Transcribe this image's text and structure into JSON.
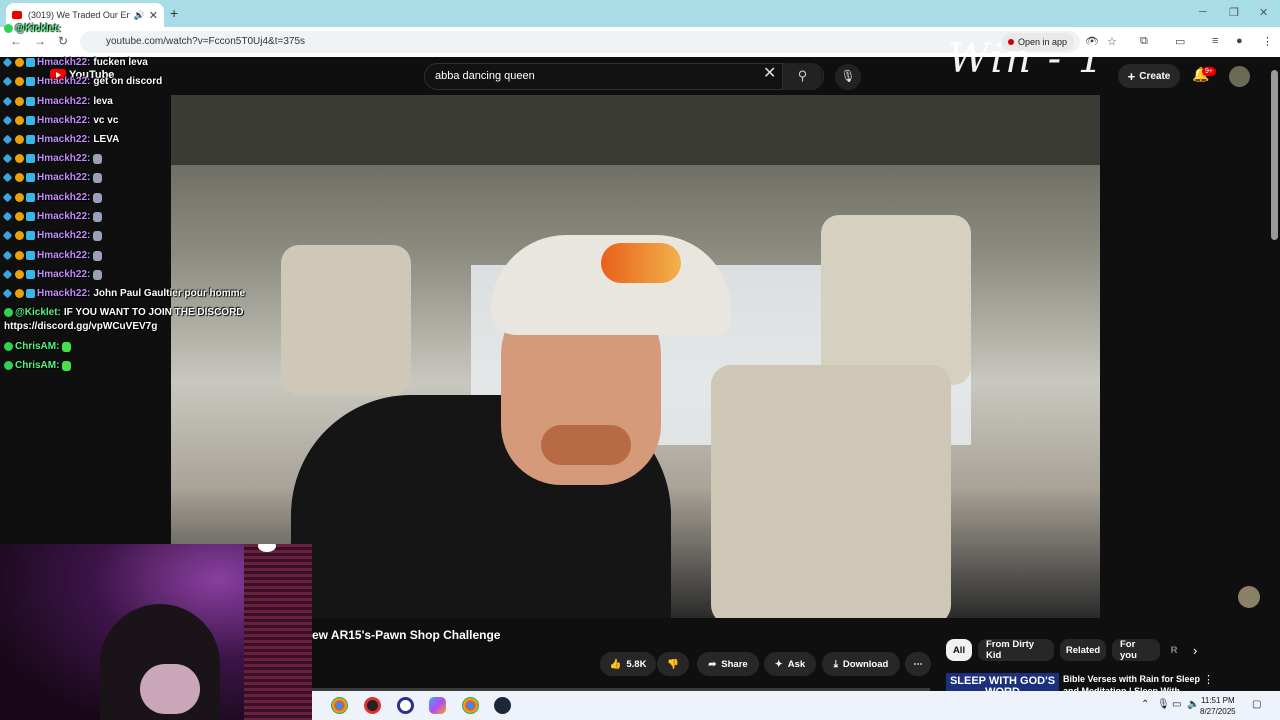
{
  "browser": {
    "tab_title": "(3019) We Traded Our Ent...",
    "url": "youtube.com/watch?v=Fccon5T0Uj4&t=375s",
    "open_in_app": "Open in app"
  },
  "youtube": {
    "logo_text": "YouTube",
    "search_value": "abba dancing queen",
    "create_label": "Create",
    "notif_badge": "9+",
    "video_title": "ew AR15's-Pawn Shop Challenge",
    "like_count": "5.8K",
    "share_label": "Share",
    "ask_label": "Ask",
    "download_label": "Download",
    "chips": [
      "All",
      "From Dirty Kid",
      "Related",
      "For you",
      "R"
    ],
    "rec": {
      "thumb_text": "SLEEP WITH GOD'S WORD",
      "title": "Bible Verses with Rain for Sleep and Meditation | Sleep With"
    }
  },
  "overlay": {
    "win_text": "Win - 1"
  },
  "chat": [
    {
      "user": "@Kicklet:",
      "text": "",
      "color": "green"
    },
    {
      "user": "Hmackh22:",
      "text": "fucken leva",
      "color": "purple"
    },
    {
      "user": "Hmackh22:",
      "text": "get on discord",
      "color": "purple"
    },
    {
      "user": "Hmackh22:",
      "text": "leva",
      "color": "purple"
    },
    {
      "user": "Hmackh22:",
      "text": "vc vc",
      "color": "purple"
    },
    {
      "user": "Hmackh22:",
      "text": "LEVA",
      "color": "purple"
    },
    {
      "user": "Hmackh22:",
      "text": "",
      "color": "purple"
    },
    {
      "user": "Hmackh22:",
      "text": "",
      "color": "purple"
    },
    {
      "user": "Hmackh22:",
      "text": "",
      "color": "purple"
    },
    {
      "user": "Hmackh22:",
      "text": "",
      "color": "purple"
    },
    {
      "user": "Hmackh22:",
      "text": "",
      "color": "purple"
    },
    {
      "user": "Hmackh22:",
      "text": "",
      "color": "purple"
    },
    {
      "user": "Hmackh22:",
      "text": "",
      "color": "purple"
    },
    {
      "user": "Hmackh22:",
      "text": "John Paul Gaultier pour homme",
      "color": "purple"
    },
    {
      "user": "@Kicklet:",
      "text": "IF YOU WANT TO JOIN THE DISCORD",
      "color": "green"
    },
    {
      "user": "",
      "text": "https://discord.gg/vpWCuVEV7g",
      "color": "white"
    },
    {
      "user": "ChrisAM:",
      "text": "",
      "color": "green"
    },
    {
      "user": "ChrisAM:",
      "text": "",
      "color": "green"
    }
  ],
  "taskbar": {
    "time": "11:51 PM",
    "date": "8/27/2025"
  }
}
